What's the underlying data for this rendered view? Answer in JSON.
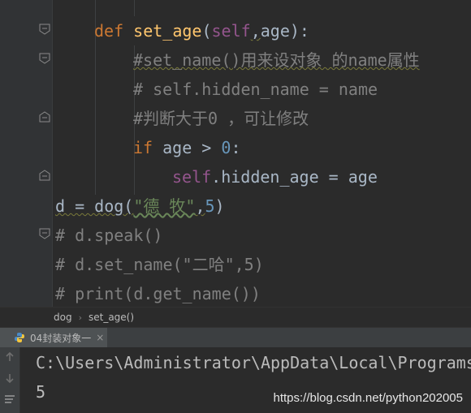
{
  "editor": {
    "lines": {
      "l1": {
        "def": "def",
        "name": "set_age",
        "open": "(",
        "self": "self",
        "comma": ",",
        "rest": "age):"
      },
      "l2": {
        "text": "#set_name()用来设对象 的name属性"
      },
      "l3": {
        "text": "# self.hidden_name = name"
      },
      "l4": {
        "text": "#判断大于0 ，可让修改"
      },
      "l5": {
        "kw": "if",
        "mid": " age > ",
        "num": "0",
        "end": ":"
      },
      "l6": {
        "self": "self",
        "rest": ".hidden_age = age"
      },
      "l7": {
        "start": "d = dog(",
        "str": "\"德 牧\"",
        "comma": ",",
        "num": "5",
        "end": ")"
      },
      "l8": {
        "text": "# d.speak()"
      },
      "l9": {
        "text": "# d.set_name(\"二哈\",5)"
      },
      "l10": {
        "text": "# print(d.get_name())"
      }
    }
  },
  "breadcrumb": {
    "items": [
      "dog",
      "set_age()"
    ],
    "separator": "›"
  },
  "run": {
    "tab_label": "04封装对象一",
    "close_glyph": "×",
    "output": [
      "C:\\Users\\Administrator\\AppData\\Local\\Programs\\Python",
      "5"
    ],
    "watermark": "https://blog.csdn.net/python202005"
  },
  "colors": {
    "background": "#2b2b2b",
    "keyword": "#cc7832",
    "function": "#ffc66d",
    "self": "#94558d",
    "number": "#6897bb",
    "string": "#6a8759",
    "comment": "#808080"
  },
  "icons": [
    "fold-marker-icon",
    "python-icon",
    "arrow-up-icon",
    "arrow-down-icon",
    "wrap-icon"
  ]
}
